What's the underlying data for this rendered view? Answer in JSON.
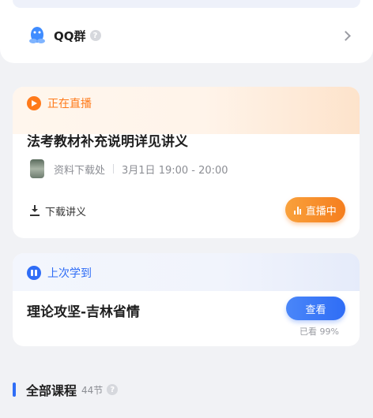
{
  "qq_group": {
    "label": "QQ群"
  },
  "live_card": {
    "status": "正在直播",
    "title": "法考教材补充说明详见讲义",
    "source": "资料下载处",
    "time": "3月1日 19:00 - 20:00",
    "download_label": "下载讲义",
    "live_button": "直播中"
  },
  "last_card": {
    "label": "上次学到",
    "course_title": "理论攻坚-吉林省情",
    "view_button": "查看",
    "progress_text": "已看 99%"
  },
  "all_courses": {
    "title": "全部课程",
    "count": "44节"
  },
  "colors": {
    "accent_blue": "#2f6df6",
    "accent_orange": "#f57e1e",
    "background": "#f1f2f5"
  }
}
